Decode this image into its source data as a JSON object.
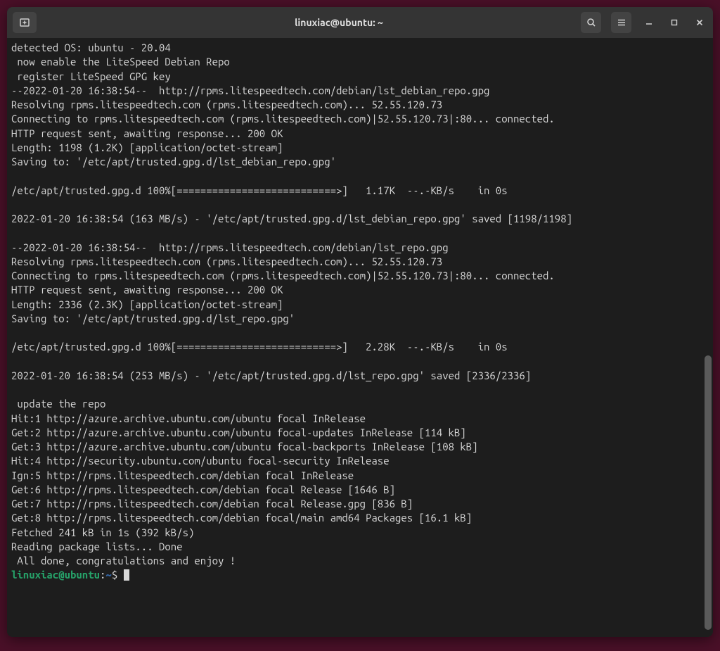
{
  "titlebar": {
    "title": "linuxiac@ubuntu: ~"
  },
  "terminal": {
    "lines": [
      "detected OS: ubuntu - 20.04",
      " now enable the LiteSpeed Debian Repo",
      " register LiteSpeed GPG key",
      "--2022-01-20 16:38:54--  http://rpms.litespeedtech.com/debian/lst_debian_repo.gpg",
      "Resolving rpms.litespeedtech.com (rpms.litespeedtech.com)... 52.55.120.73",
      "Connecting to rpms.litespeedtech.com (rpms.litespeedtech.com)|52.55.120.73|:80... connected.",
      "HTTP request sent, awaiting response... 200 OK",
      "Length: 1198 (1.2K) [application/octet-stream]",
      "Saving to: '/etc/apt/trusted.gpg.d/lst_debian_repo.gpg'",
      "",
      "/etc/apt/trusted.gpg.d 100%[===========================>]   1.17K  --.-KB/s    in 0s",
      "",
      "2022-01-20 16:38:54 (163 MB/s) - '/etc/apt/trusted.gpg.d/lst_debian_repo.gpg' saved [1198/1198]",
      "",
      "--2022-01-20 16:38:54--  http://rpms.litespeedtech.com/debian/lst_repo.gpg",
      "Resolving rpms.litespeedtech.com (rpms.litespeedtech.com)... 52.55.120.73",
      "Connecting to rpms.litespeedtech.com (rpms.litespeedtech.com)|52.55.120.73|:80... connected.",
      "HTTP request sent, awaiting response... 200 OK",
      "Length: 2336 (2.3K) [application/octet-stream]",
      "Saving to: '/etc/apt/trusted.gpg.d/lst_repo.gpg'",
      "",
      "/etc/apt/trusted.gpg.d 100%[===========================>]   2.28K  --.-KB/s    in 0s",
      "",
      "2022-01-20 16:38:54 (253 MB/s) - '/etc/apt/trusted.gpg.d/lst_repo.gpg' saved [2336/2336]",
      "",
      " update the repo",
      "Hit:1 http://azure.archive.ubuntu.com/ubuntu focal InRelease",
      "Get:2 http://azure.archive.ubuntu.com/ubuntu focal-updates InRelease [114 kB]",
      "Get:3 http://azure.archive.ubuntu.com/ubuntu focal-backports InRelease [108 kB]",
      "Hit:4 http://security.ubuntu.com/ubuntu focal-security InRelease",
      "Ign:5 http://rpms.litespeedtech.com/debian focal InRelease",
      "Get:6 http://rpms.litespeedtech.com/debian focal Release [1646 B]",
      "Get:7 http://rpms.litespeedtech.com/debian focal Release.gpg [836 B]",
      "Get:8 http://rpms.litespeedtech.com/debian focal/main amd64 Packages [16.1 kB]",
      "Fetched 241 kB in 1s (392 kB/s)",
      "Reading package lists... Done",
      " All done, congratulations and enjoy !"
    ],
    "prompt": {
      "user_host": "linuxiac@ubuntu",
      "separator": ":",
      "path": "~",
      "symbol": "$"
    }
  }
}
